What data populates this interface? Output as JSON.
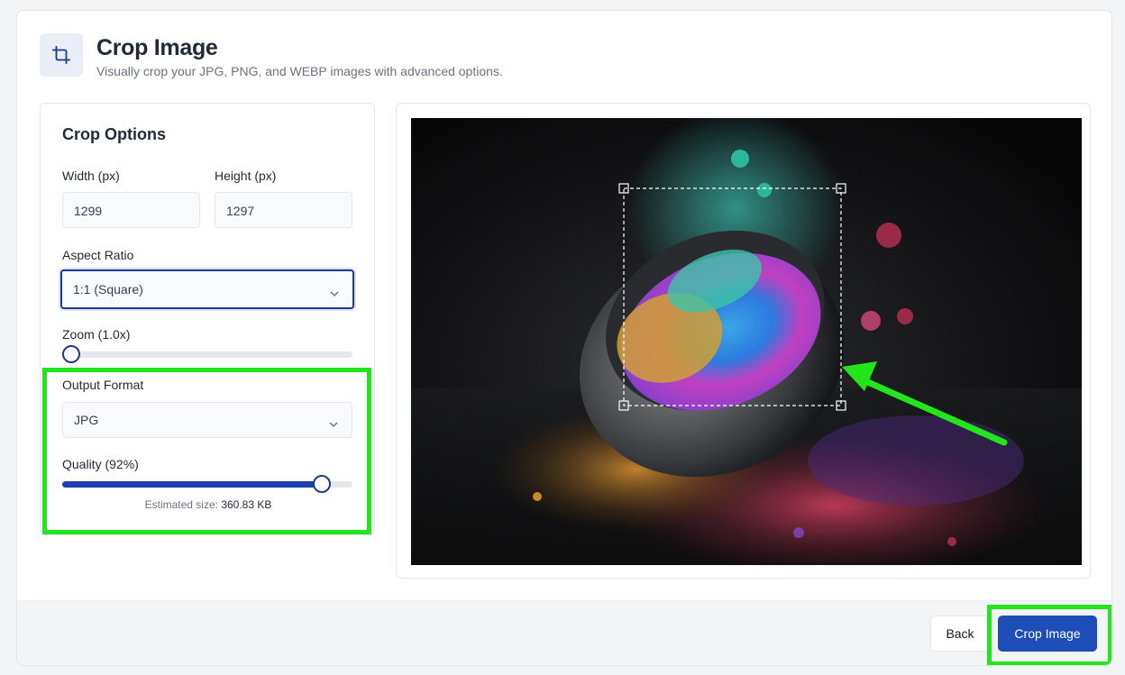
{
  "header": {
    "title": "Crop Image",
    "subtitle": "Visually crop your JPG, PNG, and WEBP images with advanced options.",
    "icon": "crop-icon"
  },
  "options": {
    "title": "Crop Options",
    "width_label": "Width (px)",
    "width_value": "1299",
    "height_label": "Height (px)",
    "height_value": "1297",
    "aspect_label": "Aspect Ratio",
    "aspect_value": "1:1 (Square)",
    "zoom_label": "Zoom (1.0x)",
    "zoom_fraction": 0.0,
    "format_label": "Output Format",
    "format_value": "JPG",
    "quality_label": "Quality (92%)",
    "quality_fraction": 0.92,
    "estimated_label": "Estimated size:",
    "estimated_value": "360.83 KB"
  },
  "footer": {
    "back_label": "Back",
    "crop_label": "Crop Image"
  },
  "colors": {
    "accent": "#1e4db7",
    "highlight": "#22e61b"
  }
}
